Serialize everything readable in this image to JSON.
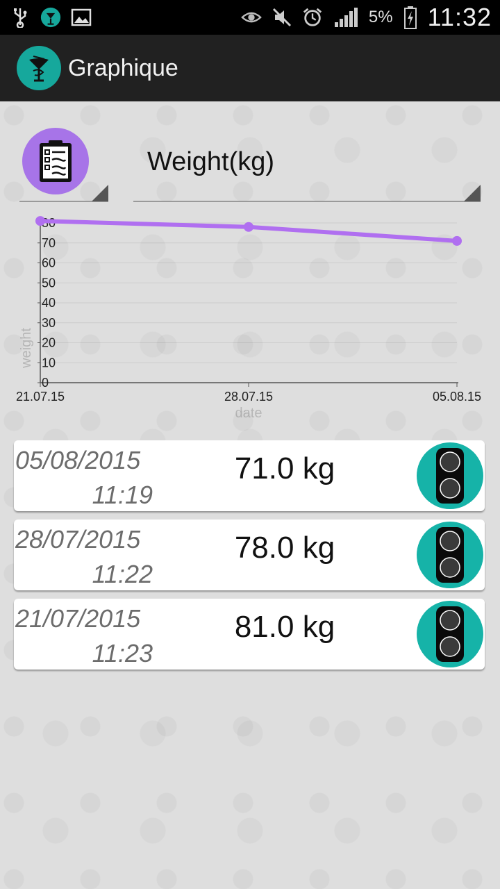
{
  "status_bar": {
    "battery_percent": "5%",
    "time": "11:32",
    "left_icons": [
      "usb-icon",
      "app-notification-icon",
      "gallery-icon"
    ],
    "right_icons": [
      "eye-icon",
      "mute-icon",
      "alarm-icon",
      "signal-icon",
      "battery-charging-icon"
    ]
  },
  "action_bar": {
    "title": "Graphique",
    "logo_icon": "caduceus-icon"
  },
  "selector": {
    "measure": "Weight(kg)",
    "list_icon": "clipboard-list-icon"
  },
  "chart_data": {
    "type": "line",
    "x": [
      "21.07.15",
      "28.07.15",
      "05.08.15"
    ],
    "values": [
      81.0,
      78.0,
      71.0
    ],
    "xlabel": "date",
    "ylabel": "weight",
    "ylim": [
      0,
      80
    ],
    "yticks": [
      "0",
      "10",
      "20",
      "30",
      "40",
      "50",
      "60",
      "70",
      "80"
    ],
    "color": "#b06ff0"
  },
  "entries": [
    {
      "date": "05/08/2015",
      "time": "11:19",
      "value": "71.0 kg",
      "icon": "traffic-light-icon"
    },
    {
      "date": "28/07/2015",
      "time": "11:22",
      "value": "78.0 kg",
      "icon": "traffic-light-icon"
    },
    {
      "date": "21/07/2015",
      "time": "11:23",
      "value": "81.0 kg",
      "icon": "traffic-light-icon"
    }
  ],
  "colors": {
    "accent_teal": "#16b3a8",
    "accent_purple": "#a774e8"
  }
}
